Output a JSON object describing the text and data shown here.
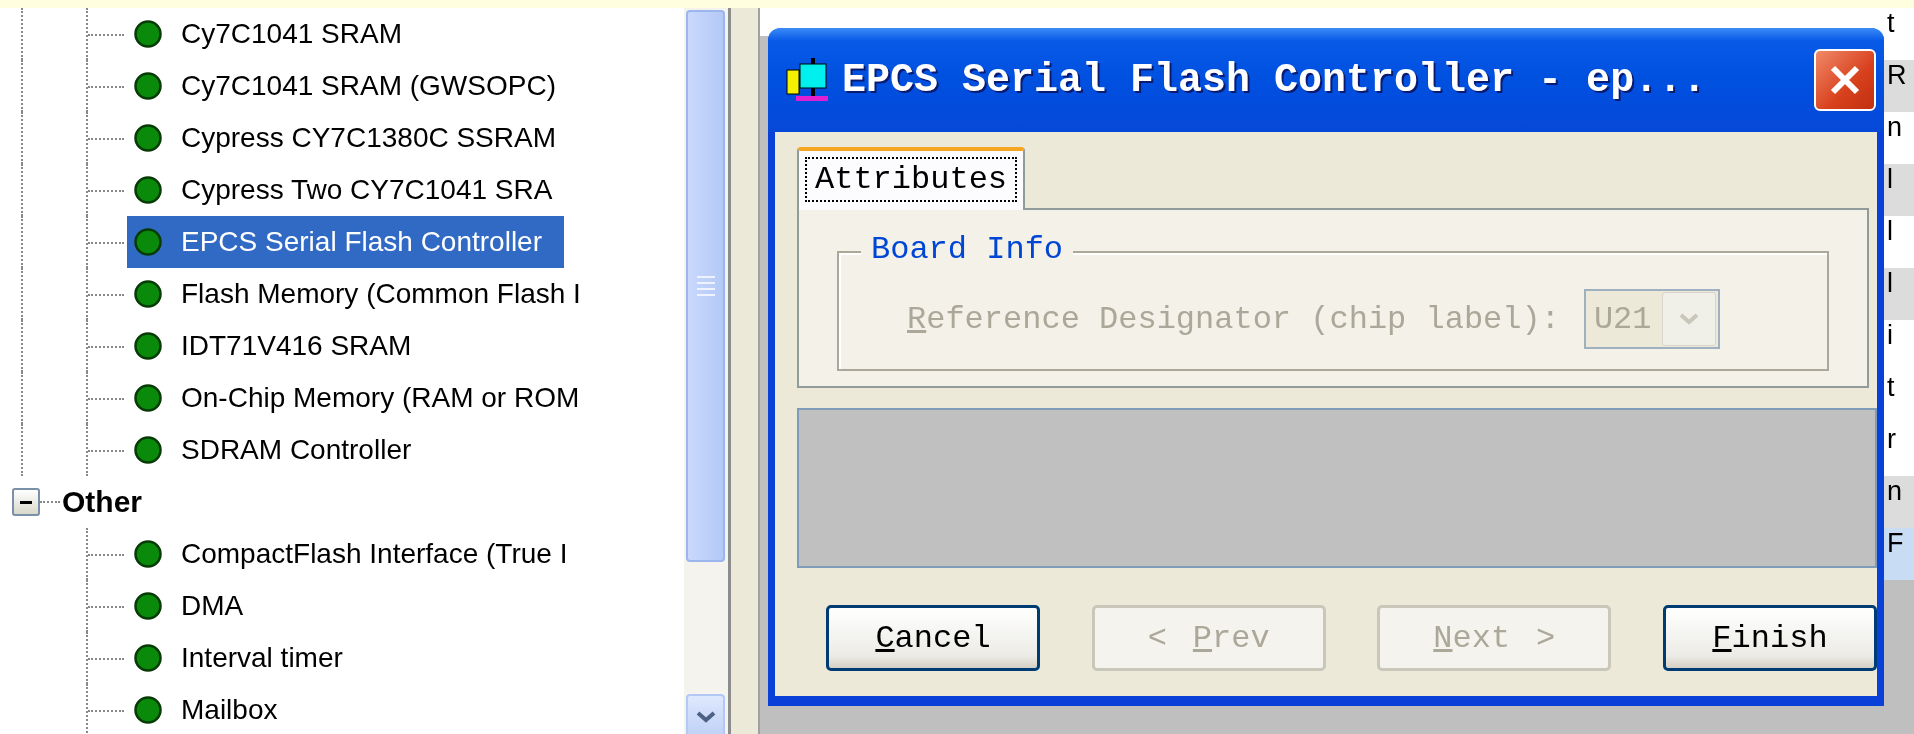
{
  "tree": [
    {
      "children": [
        {
          "label": "Cy7C1041 SRAM",
          "selected": false
        },
        {
          "label": "Cy7C1041 SRAM (GWSOPC)",
          "selected": false
        },
        {
          "label": "Cypress CY7C1380C SSRAM",
          "selected": false
        },
        {
          "label": "Cypress Two CY7C1041 SRA",
          "selected": false
        },
        {
          "label": "EPCS Serial Flash Controller",
          "selected": true
        },
        {
          "label": "Flash Memory (Common Flash I",
          "selected": false
        },
        {
          "label": "IDT71V416 SRAM",
          "selected": false
        },
        {
          "label": "On-Chip Memory (RAM or ROM",
          "selected": false
        },
        {
          "label": "SDRAM Controller",
          "selected": false
        }
      ]
    },
    {
      "label": "Other",
      "expanded": true,
      "children": [
        {
          "label": "CompactFlash Interface (True I",
          "selected": false
        },
        {
          "label": "DMA",
          "selected": false
        },
        {
          "label": "Interval timer",
          "selected": false
        },
        {
          "label": "Mailbox",
          "selected": false
        }
      ]
    }
  ],
  "side_list": [
    {
      "text": "t",
      "shaded": false,
      "selected": false
    },
    {
      "text": "R",
      "shaded": true,
      "selected": false
    },
    {
      "text": "n",
      "shaded": false,
      "selected": false
    },
    {
      "text": "l",
      "shaded": true,
      "selected": false
    },
    {
      "text": "l",
      "shaded": false,
      "selected": false
    },
    {
      "text": "l",
      "shaded": true,
      "selected": false
    },
    {
      "text": "i",
      "shaded": false,
      "selected": false
    },
    {
      "text": "t",
      "shaded": false,
      "selected": false
    },
    {
      "text": "r",
      "shaded": false,
      "selected": false
    },
    {
      "text": "n",
      "shaded": true,
      "selected": false
    },
    {
      "text": "F",
      "shaded": false,
      "selected": true
    }
  ],
  "dialog": {
    "title": "EPCS Serial Flash Controller - ep...",
    "tabs": [
      {
        "label": "Attributes",
        "selected": true
      }
    ],
    "group": {
      "title": "Board Info",
      "field": {
        "label": "Reference Designator (chip label):",
        "value": "U21",
        "disabled": true
      }
    },
    "buttons": [
      {
        "label": "Cancel",
        "kind": "plain",
        "disabled": false
      },
      {
        "label": "Prev",
        "kind": "back",
        "arrow": "<",
        "disabled": true
      },
      {
        "label": "Next",
        "kind": "forward",
        "arrow": ">",
        "disabled": true
      },
      {
        "label": "Finish",
        "kind": "plain",
        "disabled": false
      }
    ]
  }
}
